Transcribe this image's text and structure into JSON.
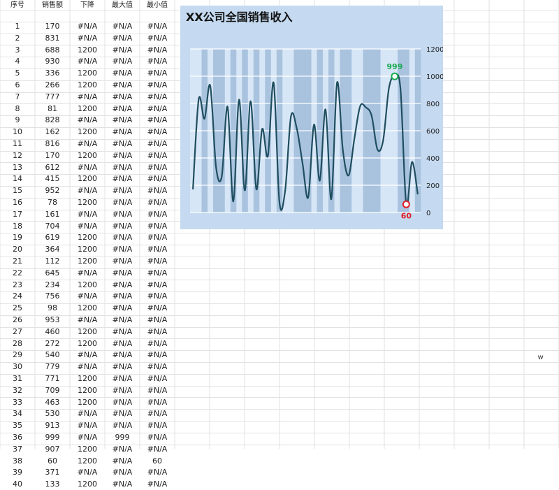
{
  "sheet": {
    "headers": [
      "序号",
      "销售额",
      "下降",
      "最大值",
      "最小值"
    ],
    "rows": [
      [
        "1",
        "170",
        "#N/A",
        "#N/A",
        "#N/A"
      ],
      [
        "2",
        "831",
        "#N/A",
        "#N/A",
        "#N/A"
      ],
      [
        "3",
        "688",
        "1200",
        "#N/A",
        "#N/A"
      ],
      [
        "4",
        "930",
        "#N/A",
        "#N/A",
        "#N/A"
      ],
      [
        "5",
        "336",
        "1200",
        "#N/A",
        "#N/A"
      ],
      [
        "6",
        "266",
        "1200",
        "#N/A",
        "#N/A"
      ],
      [
        "7",
        "777",
        "#N/A",
        "#N/A",
        "#N/A"
      ],
      [
        "8",
        "81",
        "1200",
        "#N/A",
        "#N/A"
      ],
      [
        "9",
        "828",
        "#N/A",
        "#N/A",
        "#N/A"
      ],
      [
        "10",
        "162",
        "1200",
        "#N/A",
        "#N/A"
      ],
      [
        "11",
        "816",
        "#N/A",
        "#N/A",
        "#N/A"
      ],
      [
        "12",
        "170",
        "1200",
        "#N/A",
        "#N/A"
      ],
      [
        "13",
        "612",
        "#N/A",
        "#N/A",
        "#N/A"
      ],
      [
        "14",
        "415",
        "1200",
        "#N/A",
        "#N/A"
      ],
      [
        "15",
        "952",
        "#N/A",
        "#N/A",
        "#N/A"
      ],
      [
        "16",
        "78",
        "1200",
        "#N/A",
        "#N/A"
      ],
      [
        "17",
        "161",
        "#N/A",
        "#N/A",
        "#N/A"
      ],
      [
        "18",
        "704",
        "#N/A",
        "#N/A",
        "#N/A"
      ],
      [
        "19",
        "619",
        "1200",
        "#N/A",
        "#N/A"
      ],
      [
        "20",
        "364",
        "1200",
        "#N/A",
        "#N/A"
      ],
      [
        "21",
        "112",
        "1200",
        "#N/A",
        "#N/A"
      ],
      [
        "22",
        "645",
        "#N/A",
        "#N/A",
        "#N/A"
      ],
      [
        "23",
        "234",
        "1200",
        "#N/A",
        "#N/A"
      ],
      [
        "24",
        "756",
        "#N/A",
        "#N/A",
        "#N/A"
      ],
      [
        "25",
        "98",
        "1200",
        "#N/A",
        "#N/A"
      ],
      [
        "26",
        "953",
        "#N/A",
        "#N/A",
        "#N/A"
      ],
      [
        "27",
        "460",
        "1200",
        "#N/A",
        "#N/A"
      ],
      [
        "28",
        "272",
        "1200",
        "#N/A",
        "#N/A"
      ],
      [
        "29",
        "540",
        "#N/A",
        "#N/A",
        "#N/A"
      ],
      [
        "30",
        "779",
        "#N/A",
        "#N/A",
        "#N/A"
      ],
      [
        "31",
        "771",
        "1200",
        "#N/A",
        "#N/A"
      ],
      [
        "32",
        "709",
        "1200",
        "#N/A",
        "#N/A"
      ],
      [
        "33",
        "463",
        "1200",
        "#N/A",
        "#N/A"
      ],
      [
        "34",
        "530",
        "#N/A",
        "#N/A",
        "#N/A"
      ],
      [
        "35",
        "913",
        "#N/A",
        "#N/A",
        "#N/A"
      ],
      [
        "36",
        "999",
        "#N/A",
        "999",
        "#N/A"
      ],
      [
        "37",
        "907",
        "1200",
        "#N/A",
        "#N/A"
      ],
      [
        "38",
        "60",
        "1200",
        "#N/A",
        "60"
      ],
      [
        "39",
        "371",
        "#N/A",
        "#N/A",
        "#N/A"
      ],
      [
        "40",
        "133",
        "1200",
        "#N/A",
        "#N/A"
      ]
    ],
    "stray_cell": "w"
  },
  "chart_data": {
    "type": "line",
    "title": "XX公司全国销售收入",
    "x": [
      1,
      2,
      3,
      4,
      5,
      6,
      7,
      8,
      9,
      10,
      11,
      12,
      13,
      14,
      15,
      16,
      17,
      18,
      19,
      20,
      21,
      22,
      23,
      24,
      25,
      26,
      27,
      28,
      29,
      30,
      31,
      32,
      33,
      34,
      35,
      36,
      37,
      38,
      39,
      40
    ],
    "series": [
      {
        "values": [
          170,
          831,
          688,
          930,
          336,
          266,
          777,
          81,
          828,
          162,
          816,
          170,
          612,
          415,
          952,
          78,
          161,
          704,
          619,
          364,
          112,
          645,
          234,
          756,
          98,
          953,
          460,
          272,
          540,
          779,
          771,
          709,
          463,
          530,
          913,
          999,
          907,
          60,
          371,
          133
        ]
      }
    ],
    "decline_bars": [
      false,
      false,
      true,
      false,
      true,
      true,
      false,
      true,
      false,
      true,
      false,
      true,
      false,
      true,
      false,
      true,
      false,
      false,
      true,
      true,
      true,
      false,
      true,
      false,
      true,
      false,
      true,
      true,
      false,
      false,
      true,
      true,
      true,
      false,
      false,
      false,
      true,
      true,
      false,
      true
    ],
    "decline_value": 1200,
    "ylim": [
      0,
      1200
    ],
    "yticks": [
      0,
      200,
      400,
      600,
      800,
      1000,
      1200
    ],
    "max_label": "999",
    "min_label": "60",
    "max_index": 35,
    "min_index": 37,
    "grid": true,
    "colors": {
      "panel_bg": "#c5daf0",
      "plot_bg": "#d7e6f6",
      "decline_bar": "#a9c3df",
      "line": "#1f4e5f",
      "gridline": "#ffffff",
      "max": "#1aab52",
      "min": "#e0202a"
    }
  }
}
